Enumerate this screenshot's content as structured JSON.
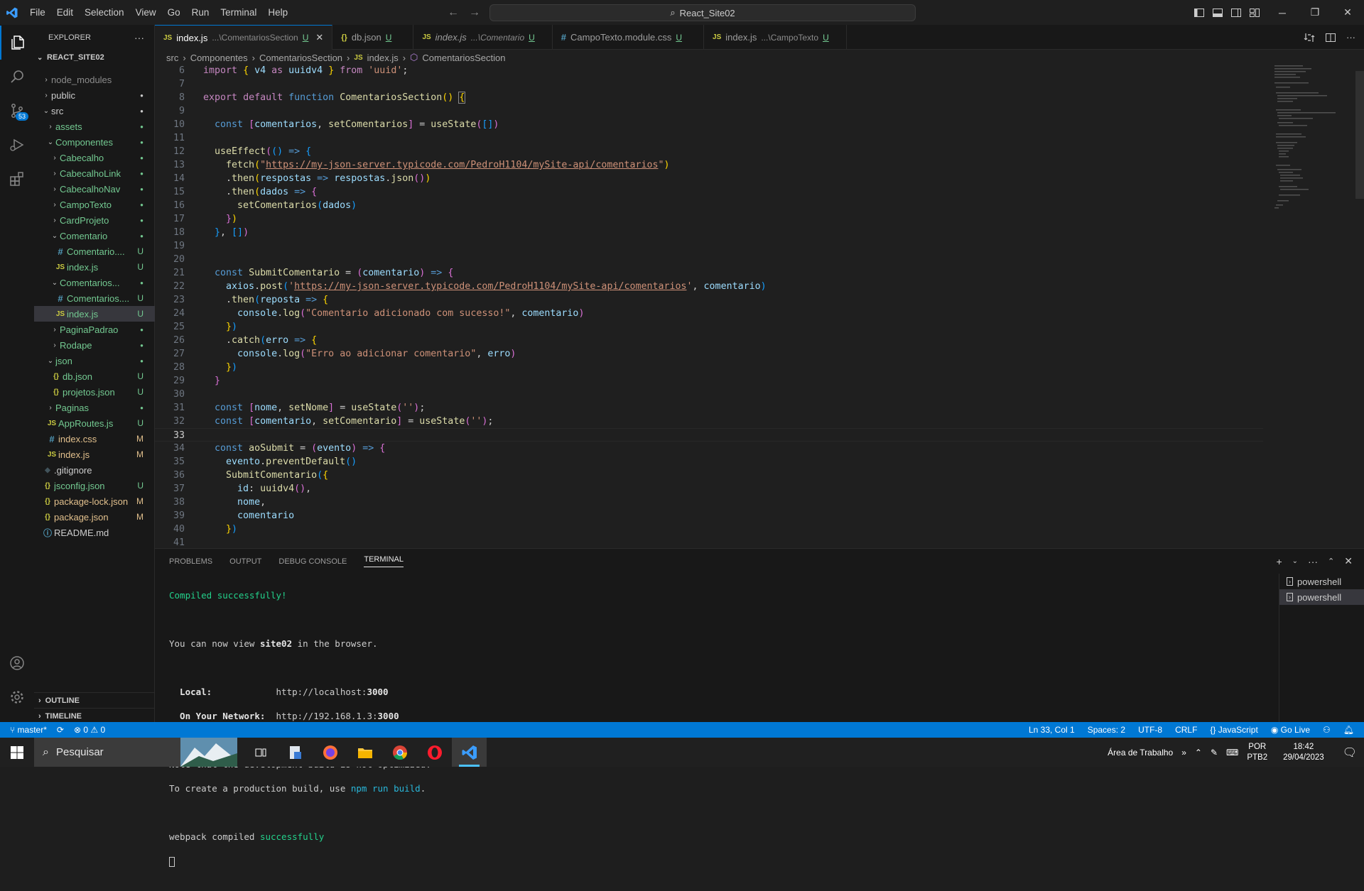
{
  "title_bar": {
    "menu": [
      "File",
      "Edit",
      "Selection",
      "View",
      "Go",
      "Run",
      "Terminal",
      "Help"
    ],
    "search_text": "React_Site02"
  },
  "explorer": {
    "header": "EXPLORER",
    "project": "REACT_SITE02",
    "items": [
      {
        "label": "node_modules",
        "status": "",
        "color": "#8b8b8b"
      },
      {
        "label": "public",
        "status": "●",
        "color": "#cccccc"
      },
      {
        "label": "src",
        "status": "●",
        "color": "#cccccc"
      },
      {
        "label": "assets",
        "status": "●",
        "color": "#73c991"
      },
      {
        "label": "Componentes",
        "status": "●",
        "color": "#73c991"
      },
      {
        "label": "Cabecalho",
        "status": "●",
        "color": "#73c991"
      },
      {
        "label": "CabecalhoLink",
        "status": "●",
        "color": "#73c991"
      },
      {
        "label": "CabecalhoNav",
        "status": "●",
        "color": "#73c991"
      },
      {
        "label": "CampoTexto",
        "status": "●",
        "color": "#73c991"
      },
      {
        "label": "CardProjeto",
        "status": "●",
        "color": "#73c991"
      },
      {
        "label": "Comentario",
        "status": "●",
        "color": "#73c991"
      },
      {
        "label": "Comentario....",
        "status": "U",
        "color": "#73c991"
      },
      {
        "label": "index.js",
        "status": "U",
        "color": "#73c991"
      },
      {
        "label": "Comentarios...",
        "status": "●",
        "color": "#73c991"
      },
      {
        "label": "Comentarios....",
        "status": "U",
        "color": "#73c991"
      },
      {
        "label": "index.js",
        "status": "U",
        "color": "#73c991"
      },
      {
        "label": "PaginaPadrao",
        "status": "●",
        "color": "#73c991"
      },
      {
        "label": "Rodape",
        "status": "●",
        "color": "#73c991"
      },
      {
        "label": "json",
        "status": "●",
        "color": "#73c991"
      },
      {
        "label": "db.json",
        "status": "U",
        "color": "#73c991"
      },
      {
        "label": "projetos.json",
        "status": "U",
        "color": "#73c991"
      },
      {
        "label": "Paginas",
        "status": "●",
        "color": "#73c991"
      },
      {
        "label": "AppRoutes.js",
        "status": "U",
        "color": "#73c991"
      },
      {
        "label": "index.css",
        "status": "M",
        "color": "#e2c08d"
      },
      {
        "label": "index.js",
        "status": "M",
        "color": "#e2c08d"
      },
      {
        "label": ".gitignore",
        "status": "",
        "color": "#cccccc"
      },
      {
        "label": "jsconfig.json",
        "status": "U",
        "color": "#73c991"
      },
      {
        "label": "package-lock.json",
        "status": "M",
        "color": "#e2c08d"
      },
      {
        "label": "package.json",
        "status": "M",
        "color": "#e2c08d"
      },
      {
        "label": "README.md",
        "status": "",
        "color": "#cccccc"
      }
    ],
    "outline": "OUTLINE",
    "timeline": "TIMELINE"
  },
  "tabs": [
    {
      "name": "index.js",
      "desc": "...\\ComentariosSection",
      "status": "U",
      "close": "✕"
    },
    {
      "name": "db.json",
      "desc": "",
      "status": "U",
      "close": ""
    },
    {
      "name": "index.js",
      "desc": "...\\Comentario",
      "status": "U",
      "close": ""
    },
    {
      "name": "CampoTexto.module.css",
      "desc": "",
      "status": "U",
      "close": ""
    },
    {
      "name": "index.js",
      "desc": "...\\CampoTexto",
      "status": "U",
      "close": ""
    }
  ],
  "breadcrumb": [
    "src",
    "Componentes",
    "ComentariosSection",
    "index.js",
    "ComentariosSection"
  ],
  "line_numbers": [
    "6",
    "7",
    "8",
    "9",
    "10",
    "11",
    "12",
    "13",
    "14",
    "15",
    "16",
    "17",
    "18",
    "19",
    "20",
    "21",
    "22",
    "23",
    "24",
    "25",
    "26",
    "27",
    "28",
    "29",
    "30",
    "31",
    "32",
    "33",
    "34",
    "35",
    "36",
    "37",
    "38",
    "39",
    "40",
    "41"
  ],
  "panel": {
    "tabs": [
      "PROBLEMS",
      "OUTPUT",
      "DEBUG CONSOLE",
      "TERMINAL"
    ],
    "terminals": [
      "powershell",
      "powershell"
    ],
    "terminal_lines": {
      "compiled": "Compiled successfully!",
      "view_pre": "You can now view ",
      "app": "site02",
      "view_post": " in the browser.",
      "local_label": "  Local:",
      "local_url_pre": "            http://localhost:",
      "local_port": "3000",
      "net_label": "  On Your Network:",
      "net_url_pre": "  http://192.168.1.3:",
      "net_port": "3000",
      "note1": "Note that the development build is not optimized.",
      "note2_pre": "To create a production build, use ",
      "note2_cmd": "npm run build",
      "note2_post": ".",
      "webpack_pre": "webpack compiled ",
      "webpack_ok": "successfully"
    }
  },
  "status_bar": {
    "branch": "master*",
    "errors": "0",
    "warnings": "0",
    "position": "Ln 33, Col 1",
    "spaces": "Spaces: 2",
    "encoding": "UTF-8",
    "eol": "CRLF",
    "language": "JavaScript",
    "golive": "Go Live"
  },
  "taskbar": {
    "search": "Pesquisar",
    "desktop": "Área de Trabalho",
    "lang1": "POR",
    "lang2": "PTB2",
    "time": "18:42",
    "date": "29/04/2023",
    "scm_badge": "53"
  }
}
